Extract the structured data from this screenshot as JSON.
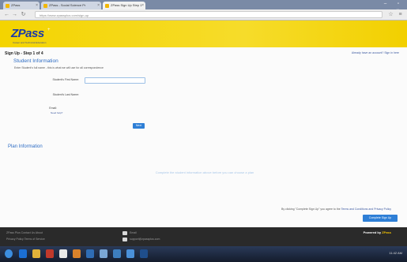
{
  "browser": {
    "tabs": [
      {
        "label": "ZPass"
      },
      {
        "label": "ZPass - Social Science Pr"
      },
      {
        "label": "ZPass Sign Up Step 1"
      }
    ],
    "url": "https://www.zpassplus.com/sign-up"
  },
  "header": {
    "logo": "ZPass",
    "tagline": "Career and Technical Education"
  },
  "page": {
    "step_title": "Sign Up - Step 1 of 4",
    "top_link": "Already have an account? Sign in here",
    "student_heading": "Student Information",
    "student_note": "Enter Student's full name - this is what we will use for all correspondence",
    "fields": {
      "first_name_label": "Student's First Name:",
      "last_name_label": "Student's Last Name:",
      "email_label": "Email:",
      "email_link": "Need help?"
    },
    "next_label": "Next",
    "plan_heading": "Plan Information",
    "plan_placeholder": "Complete the student information above before you can choose a plan",
    "terms_prefix": "By clicking \"Complete Sign Up\" you agree to the",
    "terms_link": "Terms and Conditions and Privacy Policy",
    "complete_label": "Complete Sign Up"
  },
  "footer": {
    "left_line1": "ZPass Plus  Contact Us  About",
    "left_line2": "Privacy Policy  Terms of Service",
    "mid_line1": "Email",
    "mid_line2": "support@zpassplus.com",
    "powered_label": "Powered by",
    "powered_brand": "ZPass"
  },
  "taskbar": {
    "tray_text": "11:42 AM"
  }
}
